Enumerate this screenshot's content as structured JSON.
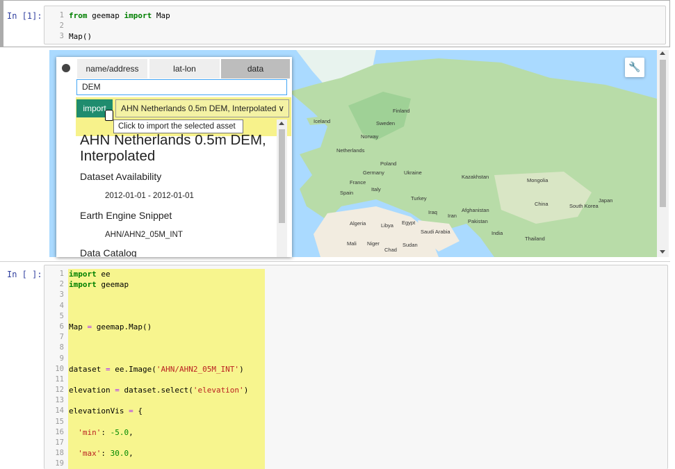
{
  "cell1": {
    "prompt": "In [1]:",
    "line_numbers": [
      "1",
      "2",
      "3"
    ],
    "lines": [
      [
        {
          "t": "from",
          "c": "kw"
        },
        {
          "t": " geemap ",
          "c": ""
        },
        {
          "t": "import",
          "c": "kw"
        },
        {
          "t": " Map",
          "c": ""
        }
      ],
      [],
      [
        {
          "t": "Map()",
          "c": ""
        }
      ]
    ]
  },
  "map": {
    "tabs": [
      "name/address",
      "lat-lon",
      "data"
    ],
    "selected_tab": "data",
    "search_value": "DEM",
    "import_label": "import",
    "selected_asset": "AHN Netherlands 0.5m DEM, Interpolated",
    "tooltip": "Click to import the selected asset",
    "dataset_title": "AHN Netherlands 0.5m DEM, Interpolated",
    "availability_label": "Dataset Availability",
    "availability_value": "2012-01-01 - 2012-01-01",
    "snippet_label": "Earth Engine Snippet",
    "snippet_value": "AHN/AHN2_05M_INT",
    "catalog_label": "Data Catalog",
    "labels": [
      "Finland",
      "Sweden",
      "Norway",
      "Iceland",
      "Netherlands",
      "Poland",
      "Germany",
      "Ukraine",
      "France",
      "Spain",
      "Italy",
      "Turkey",
      "Kazakhstan",
      "Mongolia",
      "China",
      "Iraq",
      "Iran",
      "Afghanistan",
      "Pakistan",
      "India",
      "Algeria",
      "Libya",
      "Egypt",
      "Saudi Arabia",
      "Mali",
      "Niger",
      "Chad",
      "Sudan",
      "Thailand",
      "South Korea",
      "Japan"
    ],
    "colors": {
      "water": "#aadaff",
      "land": "#b8dca8",
      "desert": "#f2ece0"
    }
  },
  "cell2": {
    "prompt": "In [ ]:",
    "line_numbers": [
      "1",
      "2",
      "3",
      "4",
      "5",
      "6",
      "7",
      "8",
      "9",
      "10",
      "11",
      "12",
      "13",
      "14",
      "15",
      "16",
      "17",
      "18",
      "19"
    ],
    "lines": [
      [
        {
          "t": "import",
          "c": "kw"
        },
        {
          "t": " ee",
          "c": ""
        }
      ],
      [
        {
          "t": "import",
          "c": "kw"
        },
        {
          "t": " geemap",
          "c": ""
        }
      ],
      [],
      [],
      [],
      [
        {
          "t": "Map ",
          "c": ""
        },
        {
          "t": "=",
          "c": "op"
        },
        {
          "t": " geemap.Map()",
          "c": ""
        }
      ],
      [],
      [],
      [],
      [
        {
          "t": "dataset ",
          "c": ""
        },
        {
          "t": "=",
          "c": "op"
        },
        {
          "t": " ee.Image(",
          "c": ""
        },
        {
          "t": "'AHN/AHN2_05M_INT'",
          "c": "str"
        },
        {
          "t": ")",
          "c": ""
        }
      ],
      [],
      [
        {
          "t": "elevation ",
          "c": ""
        },
        {
          "t": "=",
          "c": "op"
        },
        {
          "t": " dataset.select(",
          "c": ""
        },
        {
          "t": "'elevation'",
          "c": "str"
        },
        {
          "t": ")",
          "c": ""
        }
      ],
      [],
      [
        {
          "t": "elevationVis ",
          "c": ""
        },
        {
          "t": "=",
          "c": "op"
        },
        {
          "t": " {",
          "c": ""
        }
      ],
      [],
      [
        {
          "t": "  ",
          "c": ""
        },
        {
          "t": "'min'",
          "c": "str"
        },
        {
          "t": ": ",
          "c": ""
        },
        {
          "t": "-5.0",
          "c": "num"
        },
        {
          "t": ",",
          "c": ""
        }
      ],
      [],
      [
        {
          "t": "  ",
          "c": ""
        },
        {
          "t": "'max'",
          "c": "str"
        },
        {
          "t": ": ",
          "c": ""
        },
        {
          "t": "30.0",
          "c": "num"
        },
        {
          "t": ",",
          "c": ""
        }
      ],
      []
    ]
  }
}
